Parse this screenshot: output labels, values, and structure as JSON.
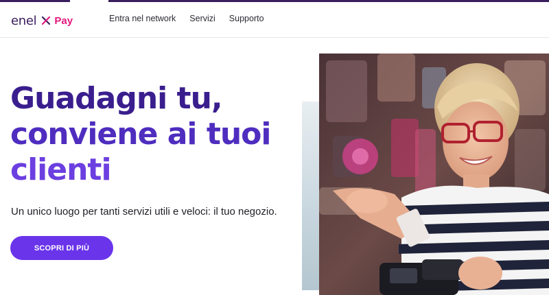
{
  "brand": {
    "name": "enel",
    "product": "Pay",
    "colors": {
      "primary_dark": "#3a1e5e",
      "accent_pink": "#e5197f",
      "accent_purple": "#6a34ea"
    }
  },
  "nav": {
    "items": [
      {
        "label": "Entra nel network"
      },
      {
        "label": "Servizi"
      },
      {
        "label": "Supporto"
      }
    ]
  },
  "hero": {
    "title_lines": [
      "Guadagni tu,",
      "conviene ai tuoi",
      "clienti"
    ],
    "subtitle": "Un unico luogo per tanti servizi utili e veloci: il tuo negozio.",
    "cta_label": "SCOPRI DI PIÙ",
    "image_icon": "shopkeeper-photo"
  }
}
